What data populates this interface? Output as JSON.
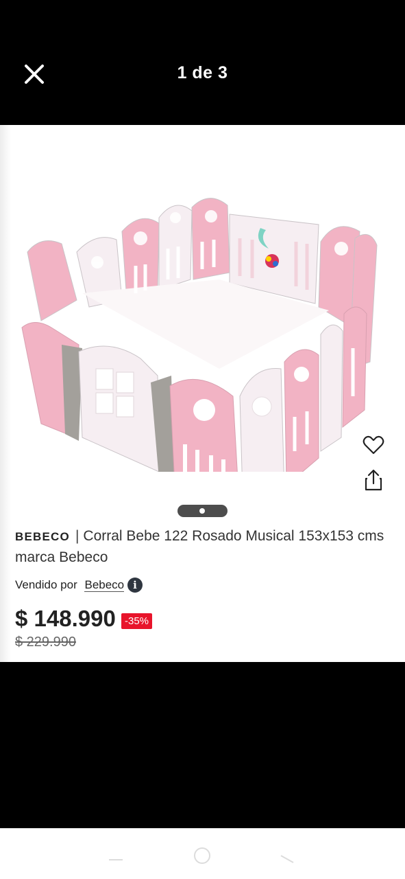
{
  "viewer": {
    "counter": "1 de 3",
    "close_icon": "close-icon"
  },
  "product": {
    "brand": "BEBECO",
    "title": "Corral Bebe 122 Rosado Musical 153x153 cms marca Bebeco",
    "seller_label": "Vendido por",
    "seller_name": "Bebeco",
    "price": "$ 148.990",
    "discount": "-35%",
    "original_price": "$ 229.990",
    "image_alt": "Corral de bebé rosado y blanco",
    "gallery_current": 1,
    "gallery_total": 3
  },
  "icons": {
    "favorite": "heart-icon",
    "share": "share-icon",
    "info": "info-icon"
  },
  "colors": {
    "discount_badge": "#e8142b",
    "pink_panel": "#f2b3c4",
    "white_panel": "#f6eef2",
    "gray_panel": "#a3a09b"
  },
  "system_nav": {
    "items": [
      "recent-apps",
      "home",
      "back"
    ]
  }
}
